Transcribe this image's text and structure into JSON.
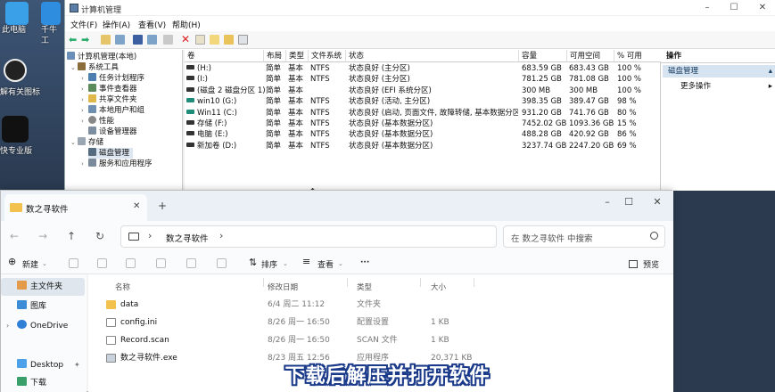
{
  "desktop": {
    "icons": [
      {
        "label": "此电脑",
        "icon": "pc-icon"
      },
      {
        "label": "千牛工",
        "icon": "qianniu-icon"
      },
      {
        "label": "解有关图标",
        "icon": "app-icon"
      },
      {
        "label": "快专业版",
        "icon": "capcut-icon"
      }
    ]
  },
  "cm": {
    "title": "计算机管理",
    "menu": [
      "文件(F)",
      "操作(A)",
      "查看(V)",
      "帮助(H)"
    ],
    "tree": [
      {
        "label": "计算机管理(本地)",
        "icon": "computer-icon"
      },
      {
        "label": "系统工具",
        "icon": "tools-icon"
      },
      {
        "label": "任务计划程序",
        "icon": "clock-icon"
      },
      {
        "label": "事件查看器",
        "icon": "event-icon"
      },
      {
        "label": "共享文件夹",
        "icon": "share-icon"
      },
      {
        "label": "本地用户和组",
        "icon": "users-icon"
      },
      {
        "label": "性能",
        "icon": "performance-icon"
      },
      {
        "label": "设备管理器",
        "icon": "device-icon"
      },
      {
        "label": "存储",
        "icon": "storage-icon"
      },
      {
        "label": "磁盘管理",
        "icon": "disk-icon"
      },
      {
        "label": "服务和应用程序",
        "icon": "services-icon"
      }
    ],
    "columns": [
      "卷",
      "布局",
      "类型",
      "文件系统",
      "状态",
      "容量",
      "可用空间",
      "% 可用"
    ],
    "volumes": [
      [
        "(H:)",
        "简单",
        "基本",
        "NTFS",
        "状态良好 (主分区)",
        "683.59 GB",
        "683.43 GB",
        "100 %"
      ],
      [
        "(I:)",
        "简单",
        "基本",
        "NTFS",
        "状态良好 (主分区)",
        "781.25 GB",
        "781.08 GB",
        "100 %"
      ],
      [
        "(磁盘 2 磁盘分区 1)",
        "简单",
        "基本",
        "",
        "状态良好 (EFI 系统分区)",
        "300 MB",
        "300 MB",
        "100 %"
      ],
      [
        "win10 (G:)",
        "简单",
        "基本",
        "NTFS",
        "状态良好 (活动, 主分区)",
        "398.35 GB",
        "389.47 GB",
        "98 %"
      ],
      [
        "Win11 (C:)",
        "简单",
        "基本",
        "NTFS",
        "状态良好 (启动, 页面文件, 故障转储, 基本数据分区)",
        "931.20 GB",
        "741.76 GB",
        "80 %"
      ],
      [
        "存储 (F:)",
        "简单",
        "基本",
        "NTFS",
        "状态良好 (基本数据分区)",
        "7452.02 GB",
        "1093.36 GB",
        "15 %"
      ],
      [
        "电脑 (E:)",
        "简单",
        "基本",
        "NTFS",
        "状态良好 (基本数据分区)",
        "488.28 GB",
        "420.92 GB",
        "86 %"
      ],
      [
        "新加卷 (D:)",
        "简单",
        "基本",
        "NTFS",
        "状态良好 (基本数据分区)",
        "3237.74 GB",
        "2247.20 GB",
        "69 %"
      ]
    ],
    "actions": {
      "header": "操作",
      "section": "磁盘管理",
      "more": "更多操作"
    }
  },
  "explorer": {
    "tab_label": "数之寻软件",
    "address_label": "数之寻软件",
    "search_placeholder": "在 数之寻软件 中搜索",
    "cmd": {
      "new": "新建",
      "sort": "排序",
      "view": "查看",
      "more": "···",
      "preview": "预览"
    },
    "sidebar": [
      {
        "label": "主文件夹",
        "icon": "home-icon"
      },
      {
        "label": "图库",
        "icon": "gallery-icon"
      },
      {
        "label": "OneDrive",
        "icon": "cloud-icon"
      },
      {
        "label": "Desktop",
        "icon": "desktop-icon"
      },
      {
        "label": "下载",
        "icon": "download-icon"
      }
    ],
    "columns": [
      "名称",
      "修改日期",
      "类型",
      "大小"
    ],
    "files": [
      {
        "name": "data",
        "date": "6/4 周二 11:12",
        "type": "文件夹",
        "size": "",
        "icon": "folder-icon"
      },
      {
        "name": "config.ini",
        "date": "8/26 周一 16:50",
        "type": "配置设置",
        "size": "1 KB",
        "icon": "ini-file-icon"
      },
      {
        "name": "Record.scan",
        "date": "8/26 周一 16:50",
        "type": "SCAN 文件",
        "size": "1 KB",
        "icon": "file-icon"
      },
      {
        "name": "数之寻软件.exe",
        "date": "8/23 周五 12:56",
        "type": "应用程序",
        "size": "20,371 KB",
        "icon": "exe-icon"
      }
    ]
  },
  "caption": "下载后解压并打开软件"
}
